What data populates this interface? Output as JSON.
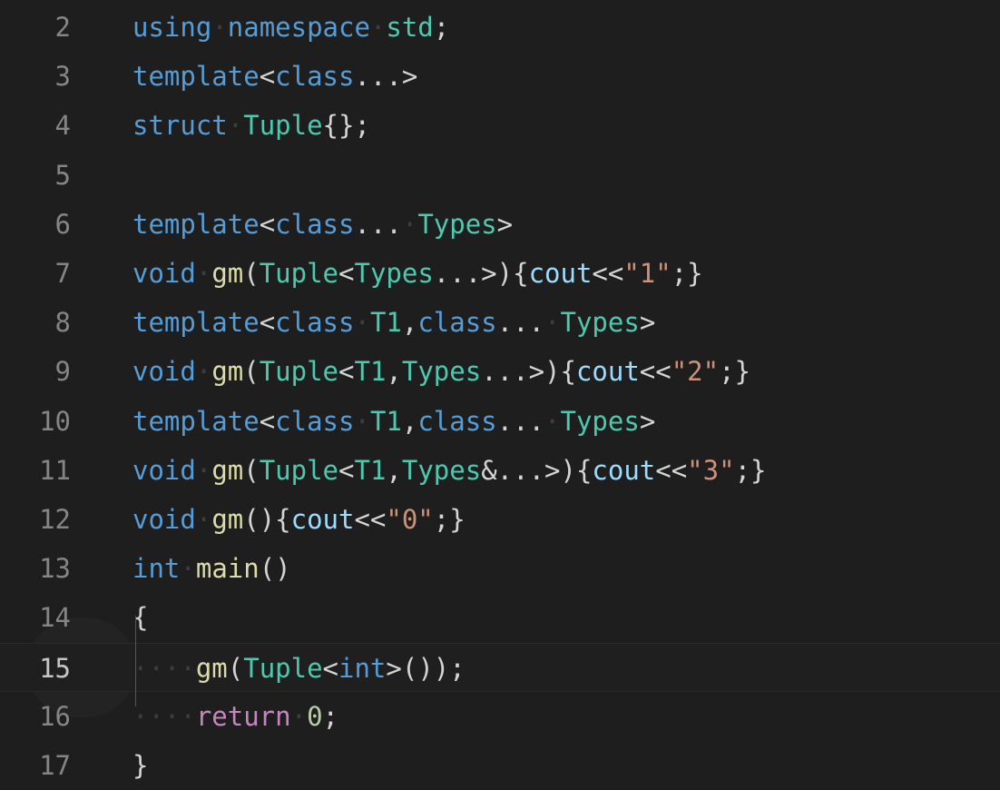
{
  "editor": {
    "active_line": "15",
    "lines": [
      {
        "num": "2",
        "tokens": [
          [
            "kw",
            "using"
          ],
          [
            "ws",
            "·"
          ],
          [
            "kw",
            "namespace"
          ],
          [
            "ws",
            "·"
          ],
          [
            "ty",
            "std"
          ],
          [
            "pl",
            ";"
          ]
        ]
      },
      {
        "num": "3",
        "tokens": [
          [
            "kw",
            "template"
          ],
          [
            "pl",
            "<"
          ],
          [
            "kw",
            "class"
          ],
          [
            "pl",
            "...>"
          ]
        ]
      },
      {
        "num": "4",
        "tokens": [
          [
            "kw",
            "struct"
          ],
          [
            "ws",
            "·"
          ],
          [
            "ty",
            "Tuple"
          ],
          [
            "pl",
            "{};"
          ]
        ]
      },
      {
        "num": "5",
        "tokens": []
      },
      {
        "num": "6",
        "tokens": [
          [
            "kw",
            "template"
          ],
          [
            "pl",
            "<"
          ],
          [
            "kw",
            "class"
          ],
          [
            "pl",
            "..."
          ],
          [
            "ws",
            "·"
          ],
          [
            "ty",
            "Types"
          ],
          [
            "pl",
            ">"
          ]
        ]
      },
      {
        "num": "7",
        "tokens": [
          [
            "kw",
            "void"
          ],
          [
            "ws",
            "·"
          ],
          [
            "fn",
            "gm"
          ],
          [
            "pl",
            "("
          ],
          [
            "ty",
            "Tuple"
          ],
          [
            "pl",
            "<"
          ],
          [
            "ty",
            "Types"
          ],
          [
            "pl",
            "...>){"
          ],
          [
            "vr",
            "cout"
          ],
          [
            "pl",
            "<<"
          ],
          [
            "st",
            "\"1\""
          ],
          [
            "pl",
            ";}"
          ]
        ]
      },
      {
        "num": "8",
        "tokens": [
          [
            "kw",
            "template"
          ],
          [
            "pl",
            "<"
          ],
          [
            "kw",
            "class"
          ],
          [
            "ws",
            "·"
          ],
          [
            "ty",
            "T1"
          ],
          [
            "pl",
            ","
          ],
          [
            "kw",
            "class"
          ],
          [
            "pl",
            "..."
          ],
          [
            "ws",
            "·"
          ],
          [
            "ty",
            "Types"
          ],
          [
            "pl",
            ">"
          ]
        ]
      },
      {
        "num": "9",
        "tokens": [
          [
            "kw",
            "void"
          ],
          [
            "ws",
            "·"
          ],
          [
            "fn",
            "gm"
          ],
          [
            "pl",
            "("
          ],
          [
            "ty",
            "Tuple"
          ],
          [
            "pl",
            "<"
          ],
          [
            "ty",
            "T1"
          ],
          [
            "pl",
            ","
          ],
          [
            "ty",
            "Types"
          ],
          [
            "pl",
            "...>){"
          ],
          [
            "vr",
            "cout"
          ],
          [
            "pl",
            "<<"
          ],
          [
            "st",
            "\"2\""
          ],
          [
            "pl",
            ";}"
          ]
        ]
      },
      {
        "num": "10",
        "tokens": [
          [
            "kw",
            "template"
          ],
          [
            "pl",
            "<"
          ],
          [
            "kw",
            "class"
          ],
          [
            "ws",
            "·"
          ],
          [
            "ty",
            "T1"
          ],
          [
            "pl",
            ","
          ],
          [
            "kw",
            "class"
          ],
          [
            "pl",
            "..."
          ],
          [
            "ws",
            "·"
          ],
          [
            "ty",
            "Types"
          ],
          [
            "pl",
            ">"
          ]
        ]
      },
      {
        "num": "11",
        "tokens": [
          [
            "kw",
            "void"
          ],
          [
            "ws",
            "·"
          ],
          [
            "fn",
            "gm"
          ],
          [
            "pl",
            "("
          ],
          [
            "ty",
            "Tuple"
          ],
          [
            "pl",
            "<"
          ],
          [
            "ty",
            "T1"
          ],
          [
            "pl",
            ","
          ],
          [
            "ty",
            "Types"
          ],
          [
            "pl",
            "&...>){"
          ],
          [
            "vr",
            "cout"
          ],
          [
            "pl",
            "<<"
          ],
          [
            "st",
            "\"3\""
          ],
          [
            "pl",
            ";}"
          ]
        ]
      },
      {
        "num": "12",
        "tokens": [
          [
            "kw",
            "void"
          ],
          [
            "ws",
            "·"
          ],
          [
            "fn",
            "gm"
          ],
          [
            "pl",
            "(){"
          ],
          [
            "vr",
            "cout"
          ],
          [
            "pl",
            "<<"
          ],
          [
            "st",
            "\"0\""
          ],
          [
            "pl",
            ";}"
          ]
        ]
      },
      {
        "num": "13",
        "tokens": [
          [
            "kw",
            "int"
          ],
          [
            "ws",
            "·"
          ],
          [
            "fn",
            "main"
          ],
          [
            "pl",
            "()"
          ]
        ]
      },
      {
        "num": "14",
        "tokens": [
          [
            "pl",
            "{"
          ]
        ]
      },
      {
        "num": "15",
        "tokens": [
          [
            "ws",
            "····"
          ],
          [
            "fn",
            "gm"
          ],
          [
            "pl",
            "("
          ],
          [
            "ty",
            "Tuple"
          ],
          [
            "pl",
            "<"
          ],
          [
            "kw",
            "int"
          ],
          [
            "pl",
            ">());"
          ]
        ]
      },
      {
        "num": "16",
        "tokens": [
          [
            "ws",
            "····"
          ],
          [
            "kwc",
            "return"
          ],
          [
            "ws",
            "·"
          ],
          [
            "num",
            "0"
          ],
          [
            "pl",
            ";"
          ]
        ]
      },
      {
        "num": "17",
        "tokens": [
          [
            "pl",
            "}"
          ]
        ]
      }
    ]
  }
}
